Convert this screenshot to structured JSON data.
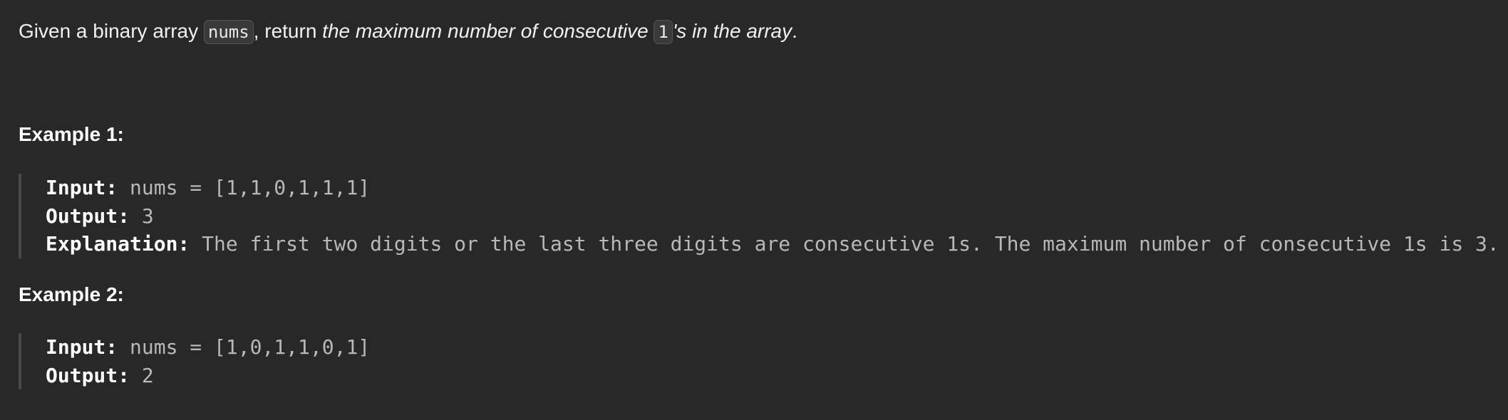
{
  "problem": {
    "intro": "Given a binary array ",
    "code_nums": "nums",
    "after_nums": ", return ",
    "italic_part": "the maximum number of consecutive ",
    "code_one": "1",
    "italic_suffix": "'s in the array",
    "period": "."
  },
  "examples": [
    {
      "heading": "Example 1:",
      "input_label": "Input:",
      "input_value": " nums = [1,1,0,1,1,1]",
      "output_label": "Output:",
      "output_value": " 3",
      "explanation_label": "Explanation:",
      "explanation_value": " The first two digits or the last three digits are consecutive 1s. The maximum number of consecutive 1s is 3."
    },
    {
      "heading": "Example 2:",
      "input_label": "Input:",
      "input_value": " nums = [1,0,1,1,0,1]",
      "output_label": "Output:",
      "output_value": " 2"
    }
  ]
}
